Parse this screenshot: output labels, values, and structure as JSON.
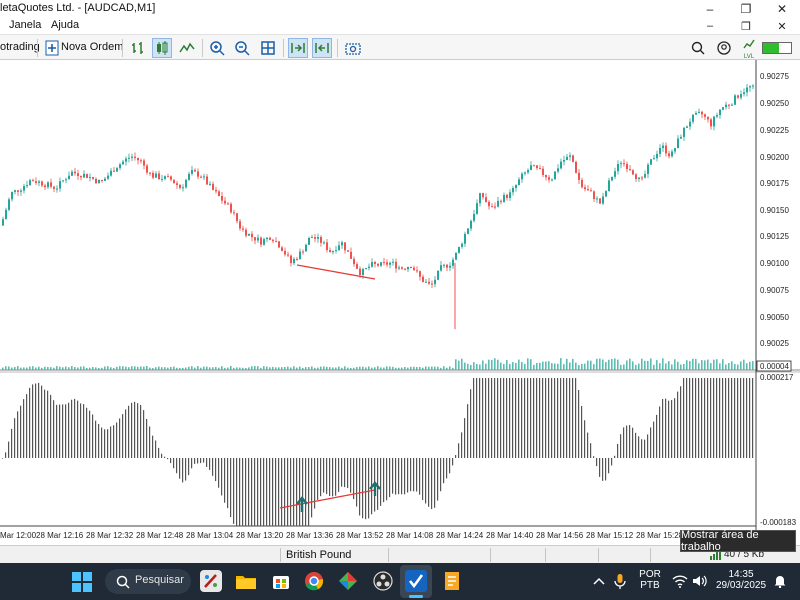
{
  "window": {
    "title": "letaQuotes Ltd. - [AUDCAD,M1]",
    "controls": [
      "–",
      "❐",
      "✕"
    ],
    "sub_controls": [
      "–",
      "❐",
      "✕"
    ]
  },
  "menu": {
    "items": [
      "Janela",
      "Ajuda"
    ]
  },
  "toolbar": {
    "algo_trading_label": "otrading",
    "new_order_label": "Nova Ordem",
    "icons": [
      "bar-chart-icon",
      "candles-icon",
      "line-chart-icon",
      "zoom-in-icon",
      "zoom-out-icon",
      "grid-icon",
      "autoscroll-icon",
      "chart-shift-icon",
      "screenshot-icon",
      "search-icon",
      "account-icon",
      "signal-icon",
      "connection-icon"
    ],
    "signal_label": "LVL"
  },
  "chart": {
    "symbol": "AUDCAD",
    "timeframe": "M1",
    "price_ticks": [
      "0.90275",
      "0.90250",
      "0.90225",
      "0.90200",
      "0.90175",
      "0.90150",
      "0.90125",
      "0.90100",
      "0.90075",
      "0.90050",
      "0.90025"
    ],
    "volume_label": "0.00004",
    "macd_top_label": "0.000217",
    "macd_bottom_label": "-0.000183",
    "time_labels": [
      "Mar 12:00",
      "28 Mar 12:16",
      "28 Mar 12:32",
      "28 Mar 12:48",
      "28 Mar 13:04",
      "28 Mar 13:20",
      "28 Mar 13:36",
      "28 Mar 13:52",
      "28 Mar 14:08",
      "28 Mar 14:24",
      "28 Mar 14:40",
      "28 Mar 14:56",
      "28 Mar 15:12",
      "28 Mar 15:28"
    ],
    "colors": {
      "bull": "#26a69a",
      "bear": "#ef5350",
      "trendline": "#e53935",
      "histogram": "#555555"
    }
  },
  "chart_data": {
    "type": "candlestick",
    "series": [
      {
        "name": "AUDCAD,M1",
        "close_path": [
          [
            0,
            0.90135
          ],
          [
            10,
            0.90165
          ],
          [
            20,
            0.9017
          ],
          [
            30,
            0.90178
          ],
          [
            40,
            0.90175
          ],
          [
            55,
            0.9017
          ],
          [
            70,
            0.90185
          ],
          [
            85,
            0.90182
          ],
          [
            100,
            0.90175
          ],
          [
            115,
            0.9019
          ],
          [
            130,
            0.902
          ],
          [
            140,
            0.90195
          ],
          [
            150,
            0.90182
          ],
          [
            160,
            0.9018
          ],
          [
            170,
            0.90178
          ],
          [
            180,
            0.9017
          ],
          [
            190,
            0.90185
          ],
          [
            200,
            0.90182
          ],
          [
            210,
            0.9017
          ],
          [
            220,
            0.9016
          ],
          [
            230,
            0.9015
          ],
          [
            240,
            0.90132
          ],
          [
            250,
            0.90125
          ],
          [
            260,
            0.9012
          ],
          [
            270,
            0.90125
          ],
          [
            280,
            0.90115
          ],
          [
            290,
            0.901
          ],
          [
            300,
            0.9011
          ],
          [
            310,
            0.90125
          ],
          [
            320,
            0.9012
          ],
          [
            330,
            0.9011
          ],
          [
            340,
            0.9012
          ],
          [
            350,
            0.90105
          ],
          [
            360,
            0.9009
          ],
          [
            370,
            0.90098
          ],
          [
            380,
            0.90098
          ],
          [
            390,
            0.901
          ],
          [
            400,
            0.90095
          ],
          [
            410,
            0.90098
          ],
          [
            420,
            0.90085
          ],
          [
            430,
            0.90078
          ],
          [
            440,
            0.90095
          ],
          [
            450,
            0.901
          ],
          [
            455,
            0.90108
          ],
          [
            460,
            0.90118
          ],
          [
            470,
            0.9014
          ],
          [
            480,
            0.90165
          ],
          [
            490,
            0.9015
          ],
          [
            500,
            0.9016
          ],
          [
            510,
            0.90165
          ],
          [
            520,
            0.9018
          ],
          [
            530,
            0.9019
          ],
          [
            540,
            0.90185
          ],
          [
            550,
            0.90178
          ],
          [
            560,
            0.90195
          ],
          [
            570,
            0.902
          ],
          [
            580,
            0.90172
          ],
          [
            590,
            0.90165
          ],
          [
            600,
            0.90155
          ],
          [
            610,
            0.9018
          ],
          [
            620,
            0.90195
          ],
          [
            630,
            0.90188
          ],
          [
            640,
            0.90175
          ],
          [
            650,
            0.90195
          ],
          [
            660,
            0.9021
          ],
          [
            670,
            0.902
          ],
          [
            680,
            0.9022
          ],
          [
            690,
            0.90235
          ],
          [
            700,
            0.9024
          ],
          [
            710,
            0.9023
          ],
          [
            720,
            0.90245
          ],
          [
            730,
            0.9025
          ],
          [
            740,
            0.9026
          ],
          [
            750,
            0.90265
          ],
          [
            756,
            0.9026
          ]
        ],
        "volume": "0.00004",
        "macd_histogram_range": [
          -0.000183,
          0.000217
        ]
      }
    ],
    "annotations": [
      "trendline",
      "up-arrow",
      "up-arrow",
      "trendline"
    ]
  },
  "statusbar": {
    "symbol_text": "British Pound",
    "traffic": "40 / 5 Kb"
  },
  "tooltip": {
    "text": "Mostrar área de trabalho"
  },
  "taskbar": {
    "search_label": "Pesquisar",
    "lang_top": "POR",
    "lang_bottom": "PTB",
    "time": "14:35",
    "date": "29/03/2025"
  }
}
